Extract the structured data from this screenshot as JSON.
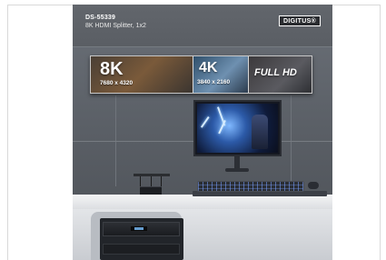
{
  "product": {
    "sku": "DS-55339",
    "subtitle": "8K HDMI Splitter, 1x2",
    "brand": "DIGITUS®"
  },
  "banner": {
    "seg_8k": {
      "big": "8K",
      "small": "7680 x 4320"
    },
    "seg_4k": {
      "big": "4K",
      "small": "3840 x 2160"
    },
    "seg_fhd": {
      "big": "FULL HD"
    }
  },
  "icons": [
    "lightning-icon"
  ],
  "colors": {
    "background": "#ffffff",
    "card_bg": "#5d6269",
    "banner_border": "#c8c8c8",
    "text_white": "#ffffff",
    "keyboard_glow": "#7aa0ff"
  }
}
